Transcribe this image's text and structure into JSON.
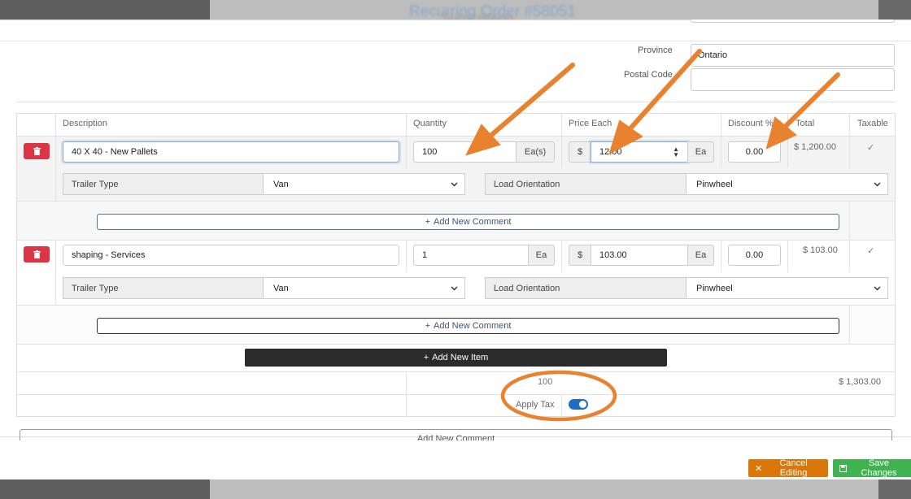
{
  "background": {
    "page_title": "Recurring Order #58051",
    "left_heading": "Subscription"
  },
  "address": {
    "province_label": "Province",
    "province_value": "Ontario",
    "postal_label": "Postal Code",
    "postal_value": ""
  },
  "table": {
    "headers": [
      "Description",
      "Quantity",
      "Price Each",
      "Discount %",
      "Total",
      "Taxable"
    ],
    "rows": [
      {
        "description": "40 X 40 - New Pallets",
        "quantity": "100",
        "quantity_unit": "Ea(s)",
        "currency": "$",
        "price": "12.00",
        "price_unit": "Ea",
        "discount": "0.00",
        "total": "$ 1,200.00",
        "taxable": "✓",
        "trailer_label": "Trailer Type",
        "trailer_value": "Van",
        "load_label": "Load Orientation",
        "load_value": "Pinwheel",
        "comment_button": "Add New Comment"
      },
      {
        "description": "shaping - Services",
        "quantity": "1",
        "quantity_unit": "Ea",
        "currency": "$",
        "price": "103.00",
        "price_unit": "Ea",
        "discount": "0.00",
        "total": "$ 103.00",
        "taxable": "✓",
        "trailer_label": "Trailer Type",
        "trailer_value": "Van",
        "load_label": "Load Orientation",
        "load_value": "Pinwheel",
        "comment_button": "Add New Comment"
      }
    ],
    "add_item_button": "Add New Item",
    "quantity_total": "100",
    "grand_total": "$ 1,303.00",
    "apply_tax_label": "Apply Tax",
    "apply_tax_on": true,
    "bottom_comment_button": "Add New Comment"
  },
  "footer": {
    "cancel_label": "Cancel Editing",
    "save_label": "Save Changes"
  },
  "colors": {
    "danger": "#dc3545",
    "cancel": "#d9770b",
    "save": "#3fb34f",
    "annotation": "#e8822f",
    "toggle": "#1f6cc4"
  },
  "icons": [
    "trash-icon",
    "plus-icon",
    "check-icon",
    "chevron-down-icon",
    "spinner-arrows-icon",
    "times-icon",
    "save-icon"
  ]
}
